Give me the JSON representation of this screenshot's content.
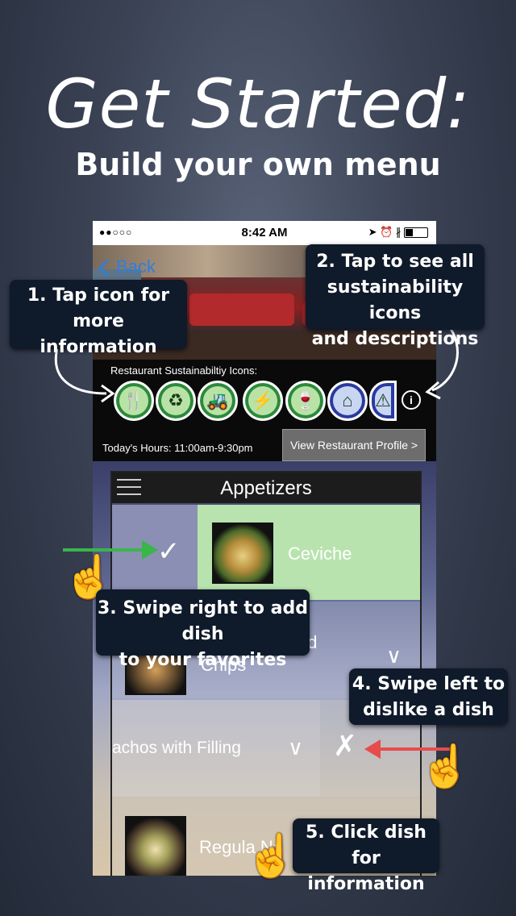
{
  "headline": "Get Started:",
  "subhead": "Build your own menu",
  "statusbar": {
    "signal": "●●○○○",
    "time": "8:42 AM",
    "icons": "➤ ⏰ ∦"
  },
  "nav": {
    "back_label": "Back"
  },
  "restaurant": {
    "icons_label": "Restaurant Sustainabiltiy Icons:",
    "sustainability_icons": [
      {
        "name": "utensils-icon",
        "glyph": "🍴"
      },
      {
        "name": "recycle-icon",
        "glyph": "♻"
      },
      {
        "name": "tractor-icon",
        "glyph": "🚜"
      },
      {
        "name": "energy-icon",
        "glyph": "⚡"
      },
      {
        "name": "wine-icon",
        "glyph": "🍷"
      },
      {
        "name": "home-heart-icon",
        "glyph": "⌂"
      },
      {
        "name": "warning-icon",
        "glyph": "⚠"
      }
    ],
    "hours": "Today's Hours: 11:00am-9:30pm",
    "profile_button": "View Restaurant Profile >"
  },
  "menu": {
    "category": "Appetizers",
    "items": [
      {
        "name": "Ceviche"
      },
      {
        "name_line1": "nd",
        "name_line2": "Chips"
      },
      {
        "name": "achos with Filling"
      },
      {
        "name": "Regula   Na"
      }
    ]
  },
  "callouts": {
    "c1": [
      "1. Tap icon for more",
      "information"
    ],
    "c2": [
      "2. Tap to see all",
      "sustainability icons",
      "and descriptions"
    ],
    "c3": [
      "3. Swipe right to add dish",
      "to your favorites"
    ],
    "c4": [
      "4. Swipe left to",
      "dislike a dish"
    ],
    "c5": [
      "5. Click dish for",
      "information"
    ]
  }
}
